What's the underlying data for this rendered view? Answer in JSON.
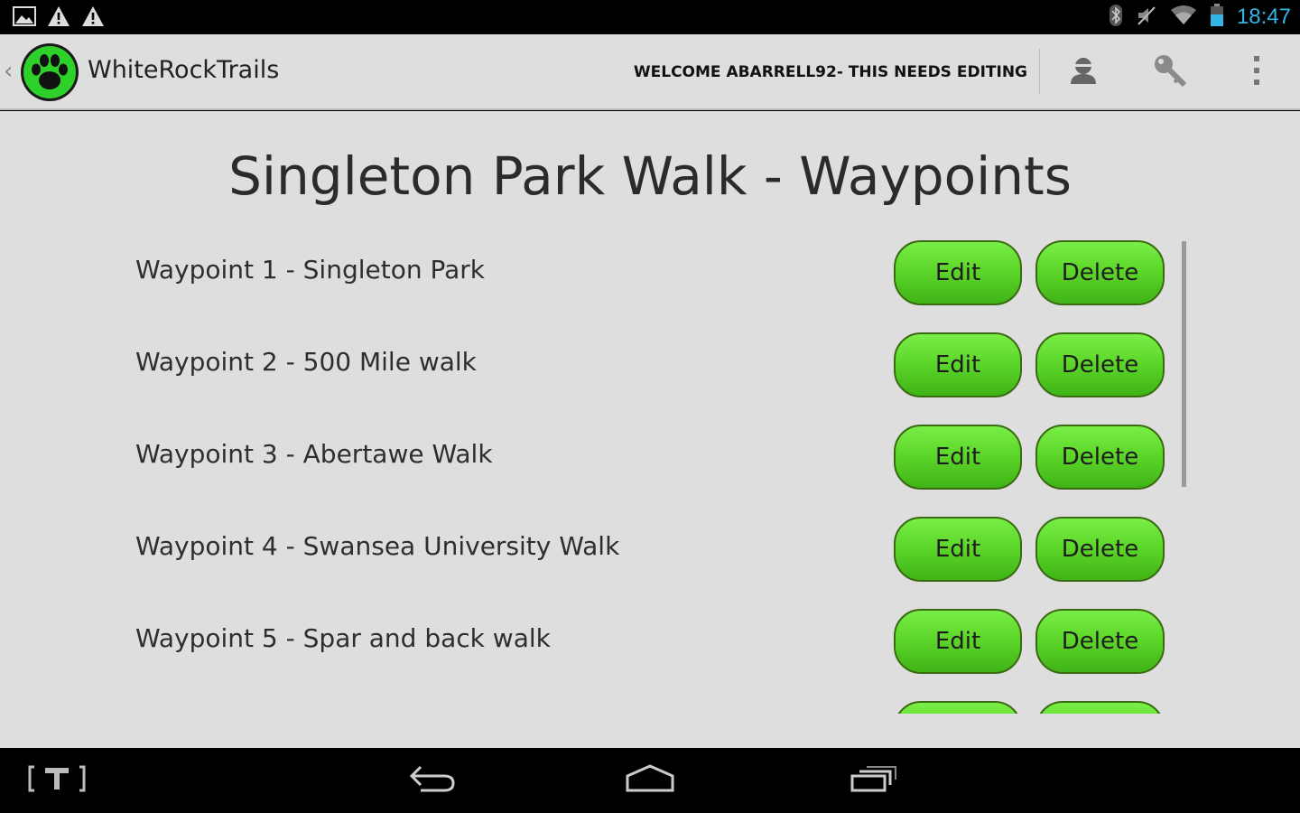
{
  "status_bar": {
    "time": "18:47",
    "left_icons": [
      "gallery-icon",
      "warning-icon",
      "warning-icon"
    ],
    "right_icons": [
      "bluetooth-icon",
      "mute-icon",
      "wifi-icon",
      "battery-icon"
    ]
  },
  "action_bar": {
    "app_title": "WhiteRockTrails",
    "welcome_text": "WELCOME ABARRELL92- THIS NEEDS EDITING",
    "actions": [
      "profile-icon",
      "key-icon",
      "overflow-menu-icon"
    ]
  },
  "page": {
    "title": "Singleton Park Walk - Waypoints",
    "edit_label": "Edit",
    "delete_label": "Delete",
    "waypoints": [
      {
        "label": "Waypoint 1 - Singleton Park"
      },
      {
        "label": "Waypoint 2 - 500 Mile walk"
      },
      {
        "label": "Waypoint 3 - Abertawe Walk"
      },
      {
        "label": "Waypoint 4 - Swansea University Walk"
      },
      {
        "label": "Waypoint 5 - Spar and back walk"
      },
      {
        "label": ""
      }
    ]
  },
  "nav_bar": {
    "buttons": [
      "text-input-icon",
      "back-icon",
      "home-icon",
      "recent-apps-icon"
    ]
  },
  "colors": {
    "accent_clock": "#33b5e5",
    "button_green": "#5ed72b",
    "background": "#dedede"
  }
}
